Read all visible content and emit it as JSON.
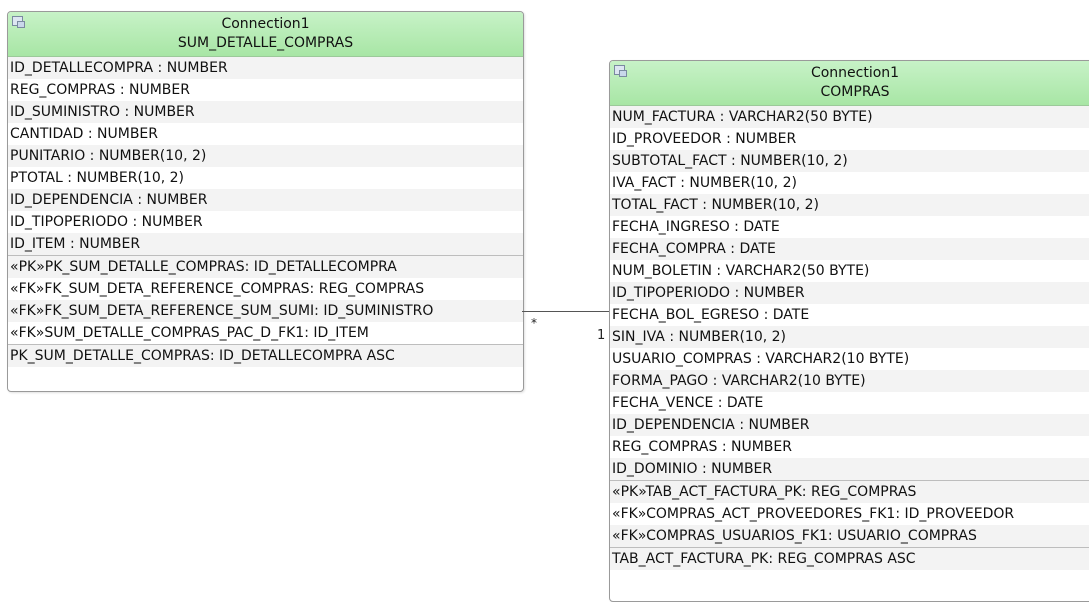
{
  "entities": {
    "detalle": {
      "connection": "Connection1",
      "name": "SUM_DETALLE_COMPRAS",
      "columns": [
        "ID_DETALLECOMPRA : NUMBER",
        "REG_COMPRAS : NUMBER",
        "ID_SUMINISTRO : NUMBER",
        "CANTIDAD : NUMBER",
        "PUNITARIO : NUMBER(10, 2)",
        "PTOTAL : NUMBER(10, 2)",
        "ID_DEPENDENCIA : NUMBER",
        "ID_TIPOPERIODO : NUMBER",
        "ID_ITEM : NUMBER"
      ],
      "keys": [
        "«PK»PK_SUM_DETALLE_COMPRAS: ID_DETALLECOMPRA",
        "«FK»FK_SUM_DETA_REFERENCE_COMPRAS: REG_COMPRAS",
        "«FK»FK_SUM_DETA_REFERENCE_SUM_SUMI: ID_SUMINISTRO",
        "«FK»SUM_DETALLE_COMPRAS_PAC_D_FK1: ID_ITEM"
      ],
      "indexes": [
        "PK_SUM_DETALLE_COMPRAS: ID_DETALLECOMPRA ASC"
      ]
    },
    "compras": {
      "connection": "Connection1",
      "name": "COMPRAS",
      "columns": [
        "NUM_FACTURA : VARCHAR2(50 BYTE)",
        "ID_PROVEEDOR : NUMBER",
        "SUBTOTAL_FACT : NUMBER(10, 2)",
        "IVA_FACT : NUMBER(10, 2)",
        "TOTAL_FACT : NUMBER(10, 2)",
        "FECHA_INGRESO : DATE",
        "FECHA_COMPRA : DATE",
        "NUM_BOLETIN : VARCHAR2(50 BYTE)",
        "ID_TIPOPERIODO : NUMBER",
        "FECHA_BOL_EGRESO : DATE",
        "SIN_IVA : NUMBER(10, 2)",
        "USUARIO_COMPRAS : VARCHAR2(10 BYTE)",
        "FORMA_PAGO : VARCHAR2(10 BYTE)",
        "FECHA_VENCE : DATE",
        "ID_DEPENDENCIA : NUMBER",
        "REG_COMPRAS : NUMBER",
        "ID_DOMINIO : NUMBER"
      ],
      "keys": [
        "«PK»TAB_ACT_FACTURA_PK: REG_COMPRAS",
        "«FK»COMPRAS_ACT_PROVEEDORES_FK1: ID_PROVEEDOR",
        "«FK»COMPRAS_USUARIOS_FK1: USUARIO_COMPRAS"
      ],
      "indexes": [
        "TAB_ACT_FACTURA_PK: REG_COMPRAS ASC"
      ]
    }
  },
  "relationship": {
    "source_cardinality": "*",
    "target_cardinality": "1"
  }
}
